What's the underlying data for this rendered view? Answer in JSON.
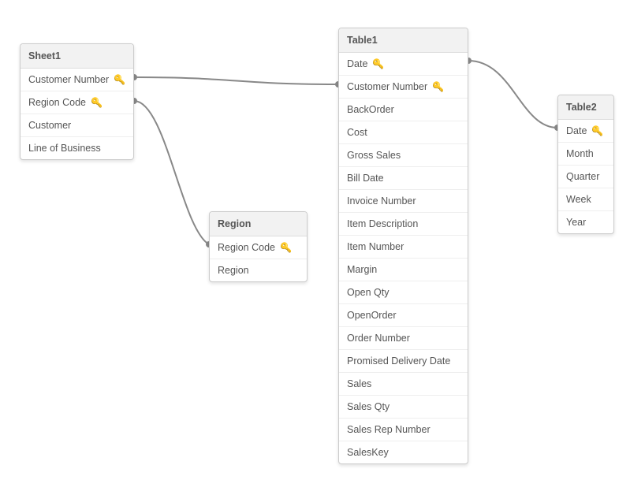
{
  "tables": {
    "sheet1": {
      "title": "Sheet1",
      "fields": [
        {
          "label": "Customer Number",
          "key": true
        },
        {
          "label": "Region Code",
          "key": true
        },
        {
          "label": "Customer",
          "key": false
        },
        {
          "label": "Line of Business",
          "key": false
        }
      ]
    },
    "region": {
      "title": "Region",
      "fields": [
        {
          "label": "Region Code",
          "key": true
        },
        {
          "label": "Region",
          "key": false
        }
      ]
    },
    "table1": {
      "title": "Table1",
      "fields": [
        {
          "label": "Date",
          "key": true
        },
        {
          "label": "Customer Number",
          "key": true
        },
        {
          "label": "BackOrder",
          "key": false
        },
        {
          "label": "Cost",
          "key": false
        },
        {
          "label": "Gross Sales",
          "key": false
        },
        {
          "label": "Bill Date",
          "key": false
        },
        {
          "label": "Invoice Number",
          "key": false
        },
        {
          "label": "Item Description",
          "key": false
        },
        {
          "label": "Item Number",
          "key": false
        },
        {
          "label": "Margin",
          "key": false
        },
        {
          "label": "Open Qty",
          "key": false
        },
        {
          "label": "OpenOrder",
          "key": false
        },
        {
          "label": "Order Number",
          "key": false
        },
        {
          "label": "Promised Delivery Date",
          "key": false
        },
        {
          "label": "Sales",
          "key": false
        },
        {
          "label": "Sales Qty",
          "key": false
        },
        {
          "label": "Sales Rep Number",
          "key": false
        },
        {
          "label": "SalesKey",
          "key": false
        }
      ]
    },
    "table2": {
      "title": "Table2",
      "fields": [
        {
          "label": "Date",
          "key": true
        },
        {
          "label": "Month",
          "key": false
        },
        {
          "label": "Quarter",
          "key": false
        },
        {
          "label": "Week",
          "key": false
        },
        {
          "label": "Year",
          "key": false
        }
      ]
    }
  },
  "relationships": [
    {
      "from": "sheet1.Customer Number",
      "to": "table1.Customer Number"
    },
    {
      "from": "sheet1.Region Code",
      "to": "region.Region Code"
    },
    {
      "from": "table1.Date",
      "to": "table2.Date"
    }
  ]
}
